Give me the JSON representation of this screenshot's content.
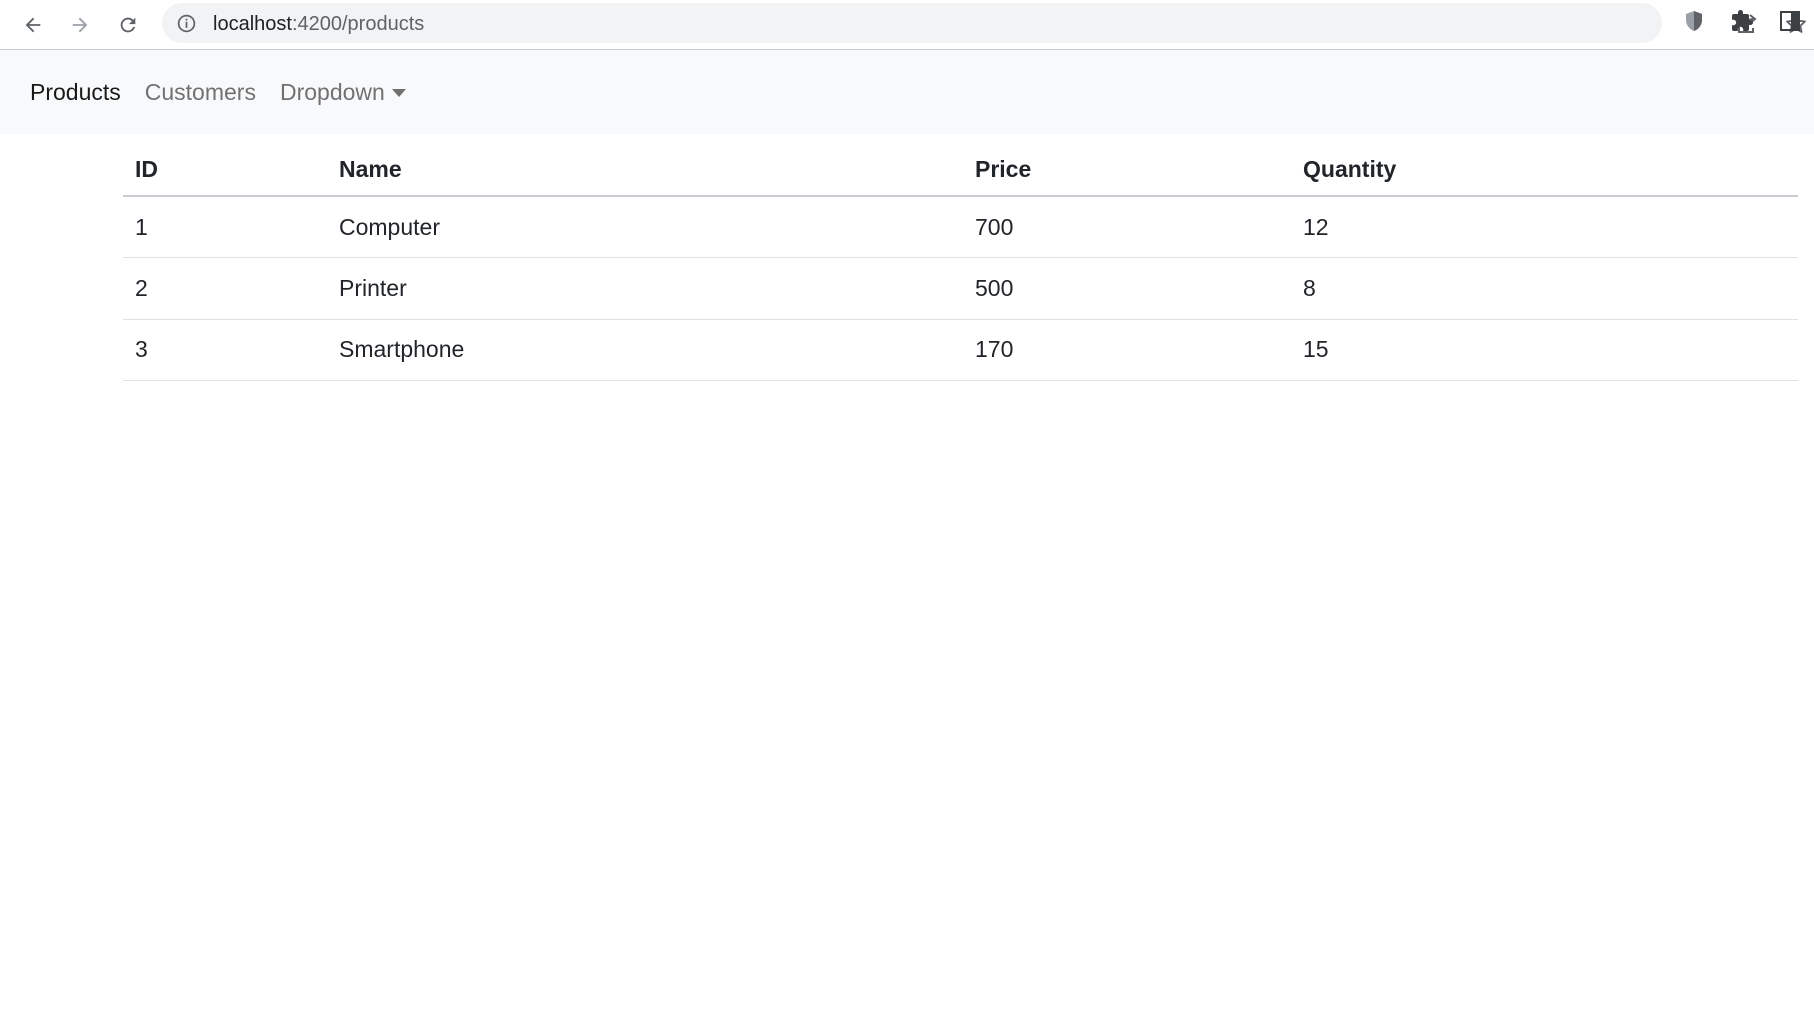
{
  "browser": {
    "url_host": "localhost",
    "url_path": ":4200/products"
  },
  "navbar": {
    "links": [
      {
        "label": "Products",
        "active": true
      },
      {
        "label": "Customers",
        "active": false
      },
      {
        "label": "Dropdown",
        "active": false
      }
    ]
  },
  "table": {
    "headers": [
      "ID",
      "Name",
      "Price",
      "Quantity"
    ],
    "rows": [
      [
        "1",
        "Computer",
        "700",
        "12"
      ],
      [
        "2",
        "Printer",
        "500",
        "8"
      ],
      [
        "3",
        "Smartphone",
        "170",
        "15"
      ]
    ]
  },
  "colors": {
    "navbar_bg": "#f8f9fa",
    "omnibox_bg": "#f1f3f4",
    "icon": "#5f6368",
    "text": "#212529"
  }
}
